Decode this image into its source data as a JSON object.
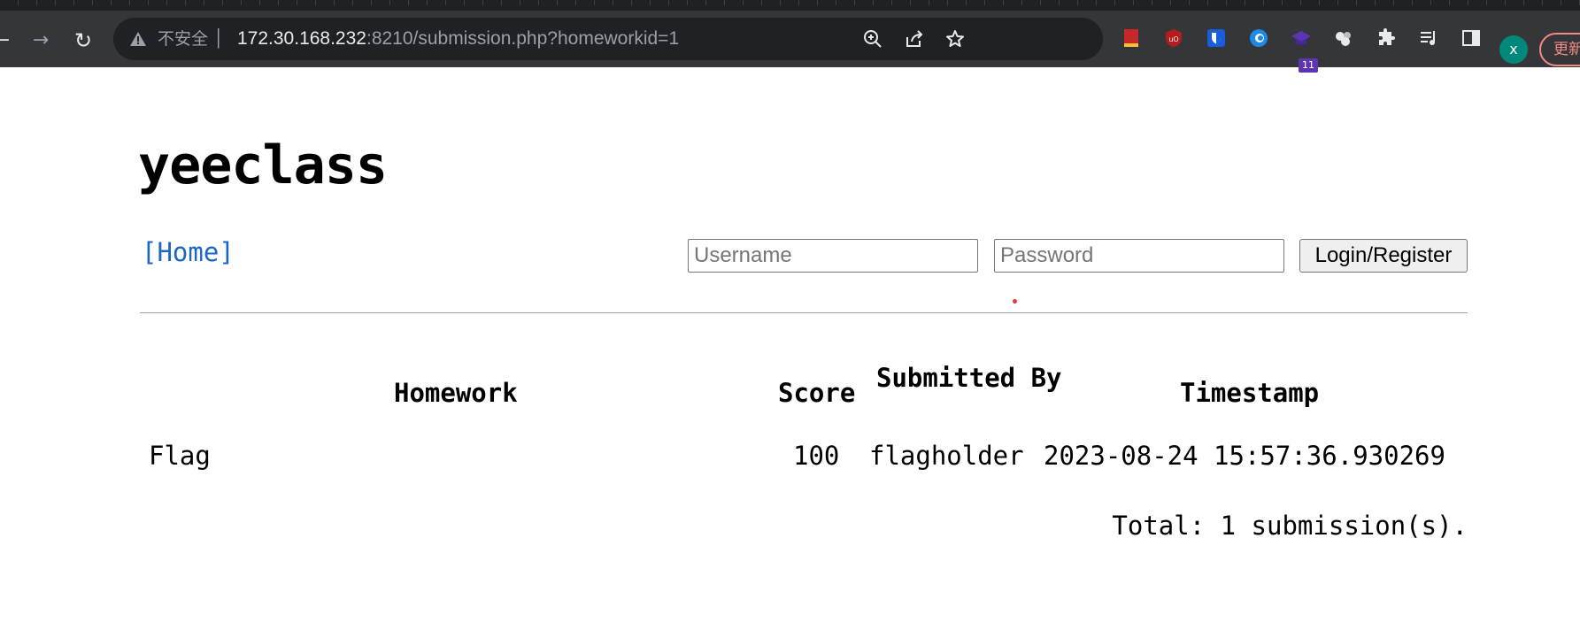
{
  "browser": {
    "security_label": "不安全",
    "url_host": "172.30.168.232",
    "url_rest": ":8210/submission.php?homeworkid=1",
    "extension_badge": "11",
    "profile_initial": "x",
    "update_label": "更新"
  },
  "site": {
    "title": "yeeclass",
    "home_link": "[Home]"
  },
  "login": {
    "username_placeholder": "Username",
    "password_placeholder": "Password",
    "submit_label": "Login/Register"
  },
  "table": {
    "headers": {
      "homework": "Homework",
      "score": "Score",
      "submitted_by": "Submitted By",
      "timestamp": "Timestamp"
    },
    "rows": [
      {
        "homework": "Flag",
        "score": "100",
        "submitted_by": "flagholder",
        "timestamp": "2023-08-24 15:57:36.930269"
      }
    ],
    "total": "Total: 1 submission(s)."
  }
}
